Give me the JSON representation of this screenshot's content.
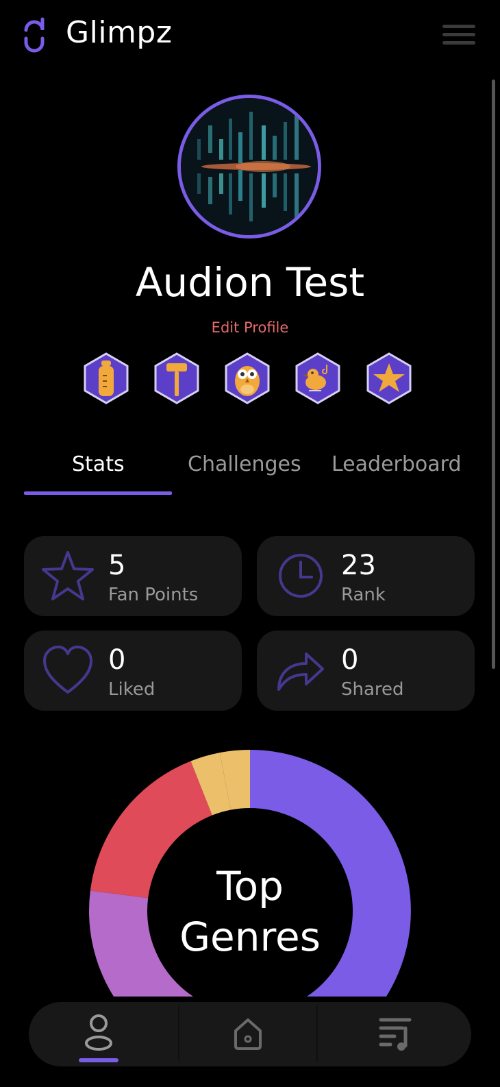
{
  "app": {
    "brand": "Glimpz"
  },
  "profile": {
    "name": "Audion Test",
    "edit_label": "Edit Profile"
  },
  "badges": [
    {
      "icon": "baby-bottle-icon"
    },
    {
      "icon": "gavel-icon"
    },
    {
      "icon": "owl-icon"
    },
    {
      "icon": "singing-bird-icon"
    },
    {
      "icon": "star-icon"
    }
  ],
  "tabs": [
    {
      "label": "Stats",
      "active": true
    },
    {
      "label": "Challenges",
      "active": false
    },
    {
      "label": "Leaderboard",
      "active": false
    }
  ],
  "stats": [
    {
      "icon": "star-outline-icon",
      "value": "5",
      "label": "Fan Points"
    },
    {
      "icon": "clock-icon",
      "value": "23",
      "label": "Rank"
    },
    {
      "icon": "heart-icon",
      "value": "0",
      "label": "Liked"
    },
    {
      "icon": "share-icon",
      "value": "0",
      "label": "Shared"
    }
  ],
  "chart": {
    "title_line1": "Top",
    "title_line2": "Genres"
  },
  "chart_data": {
    "type": "pie",
    "title": "Top Genres",
    "donut": true,
    "values": [
      0.5,
      0.07,
      0.2,
      0.17,
      0.03,
      0.03
    ],
    "colors": [
      "#7a5ce6",
      "#8e37b0",
      "#b46bc9",
      "#e04b5a",
      "#ecc06a",
      "#ecc06a"
    ]
  },
  "nav": [
    {
      "icon": "profile-icon",
      "active": true
    },
    {
      "icon": "home-icon",
      "active": false
    },
    {
      "icon": "playlist-icon",
      "active": false
    }
  ],
  "colors": {
    "accent": "#7a5ce6",
    "card": "#181818",
    "edit_link": "#e76b6b",
    "badge_fill": "#5b3fc8",
    "badge_gold": "#f2a93b"
  }
}
